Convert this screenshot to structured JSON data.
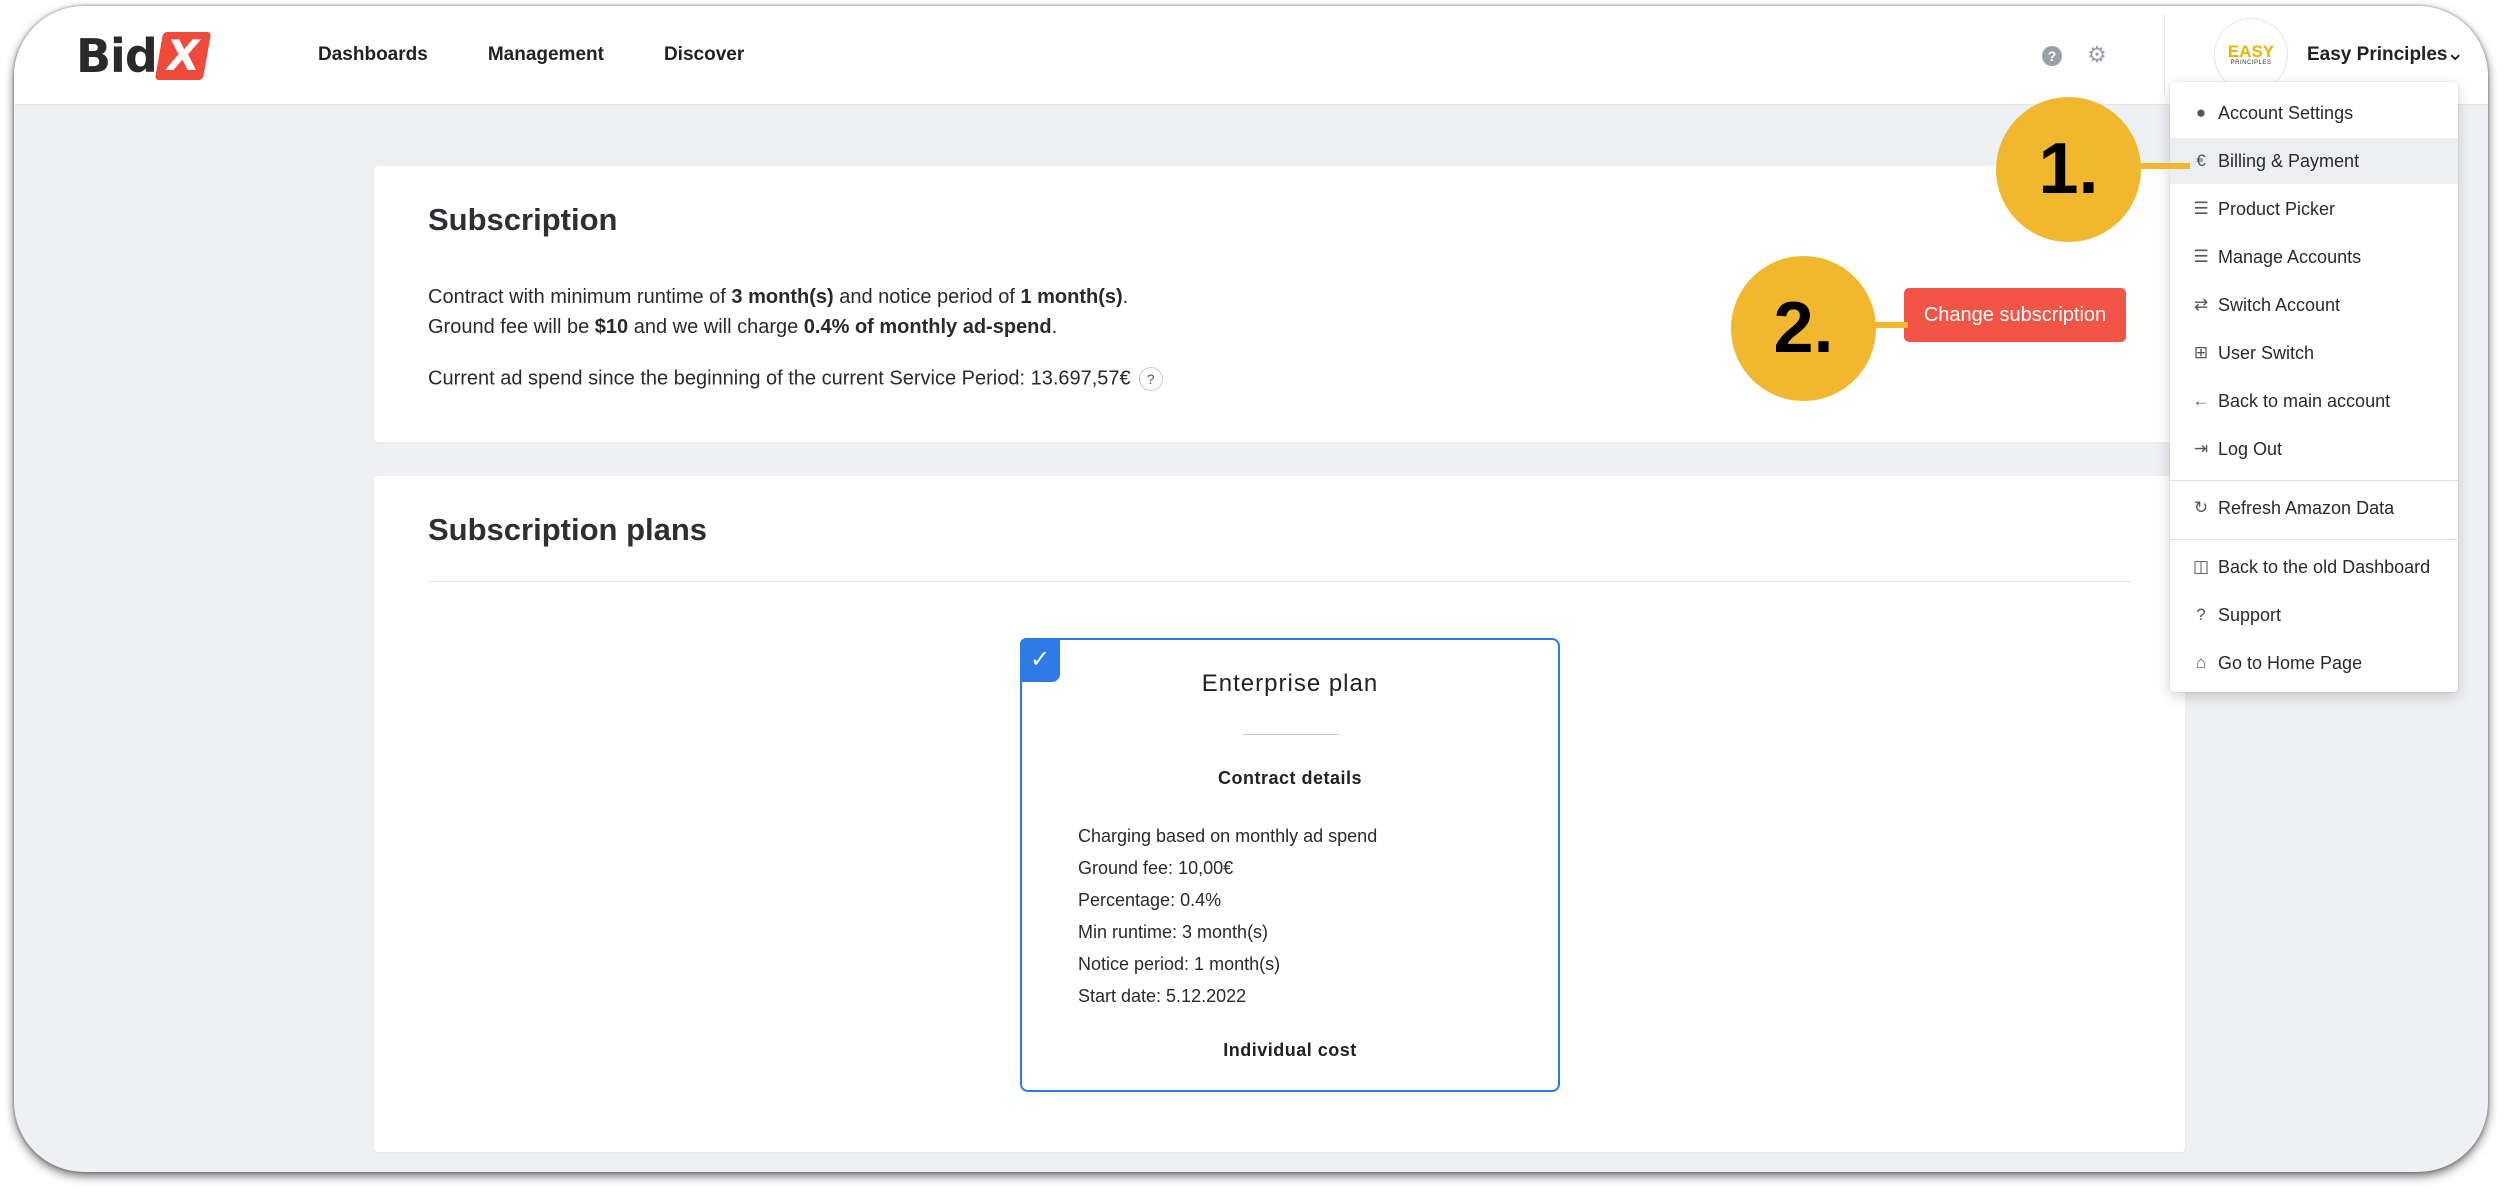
{
  "header": {
    "logo_text": "Bid",
    "logo_mark": "X",
    "nav": [
      "Dashboards",
      "Management",
      "Discover"
    ],
    "help_icon": "question-circle-icon",
    "settings_icon": "gear-icon",
    "avatar_line1": "EASY",
    "avatar_line2": "PRINCIPLES",
    "account_name": "Easy Principles",
    "account_chevron": "⌄"
  },
  "subscription": {
    "title": "Subscription",
    "line1": {
      "a": "Contract with minimum runtime of ",
      "b": "3 month(s)",
      "c": " and notice period of ",
      "d": "1 month(s)",
      "e": "."
    },
    "line2": {
      "a": "Ground fee will be ",
      "b": "$10",
      "c": " and we will charge ",
      "d": "0.4% of monthly ad-spend",
      "e": "."
    },
    "line3": "Current ad spend since the beginning of the current Service Period: 13.697,57€",
    "help_mark": "?",
    "change_button": "Change subscription"
  },
  "plans": {
    "title": "Subscription plans",
    "plan": {
      "name": "Enterprise plan",
      "section": "Contract details",
      "details": [
        "Charging based on monthly ad spend",
        "Ground fee: 10,00€",
        "Percentage: 0.4%",
        "Min runtime: 3 month(s)",
        "Notice period: 1 month(s)",
        "Start date: 5.12.2022"
      ],
      "cost": "Individual cost"
    }
  },
  "dropdown": {
    "items": [
      {
        "label": "Account Settings",
        "icon": "user-icon",
        "glyph": "👤"
      },
      {
        "label": "Billing & Payment",
        "icon": "euro-icon",
        "glyph": "€",
        "active": true
      },
      {
        "label": "Product Picker",
        "icon": "list-icon",
        "glyph": "☰"
      },
      {
        "label": "Manage Accounts",
        "icon": "list-icon",
        "glyph": "☰"
      },
      {
        "label": "Switch Account",
        "icon": "exchange-icon",
        "glyph": "⇄"
      },
      {
        "label": "User Switch",
        "icon": "sitemap-icon",
        "glyph": "⊞"
      },
      {
        "label": "Back to main account",
        "icon": "arrow-left-icon",
        "glyph": "←"
      },
      {
        "label": "Log Out",
        "icon": "logout-icon",
        "glyph": "⇥"
      },
      {
        "label": "Refresh Amazon Data",
        "icon": "refresh-icon",
        "glyph": "↻"
      },
      {
        "label": "Back to the old Dashboard",
        "icon": "columns-icon",
        "glyph": "◫"
      },
      {
        "label": "Support",
        "icon": "question-circle-icon",
        "glyph": "?"
      },
      {
        "label": "Go to Home Page",
        "icon": "home-icon",
        "glyph": "⌂"
      }
    ]
  },
  "callouts": [
    "1.",
    "2."
  ],
  "colors": {
    "accent_blue": "#2f7be5",
    "button_red": "#f25546",
    "callout_yellow": "#f0b72f",
    "logo_red": "#ef4a3c"
  }
}
